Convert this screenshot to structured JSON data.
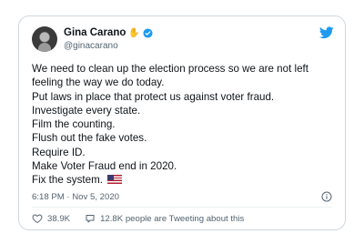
{
  "author": {
    "name": "Gina Carano",
    "handle": "@ginacarano",
    "name_emoji": "✋"
  },
  "icons": {
    "verified": "verified-badge-icon",
    "logo": "twitter-bird-icon",
    "info": "info-icon",
    "like": "heart-icon",
    "reply": "speech-bubble-icon"
  },
  "colors": {
    "brand": "#1d9bf0",
    "text": "#0f1419",
    "muted": "#536471",
    "border": "#cfd9de"
  },
  "tweet": {
    "lines": [
      "We need to clean up the election process so we are not left",
      "feeling the way we do today.",
      "Put laws in place that protect us against voter fraud.",
      "Investigate every state.",
      "Film the counting.",
      "Flush out the fake votes.",
      "Require ID.",
      "Make Voter Fraud end in 2020.",
      "Fix the system."
    ],
    "timestamp": "6:18 PM · Nov 5, 2020"
  },
  "engagement": {
    "likes": "38.9K",
    "tweeting_text": "12.8K people are Tweeting about this"
  }
}
